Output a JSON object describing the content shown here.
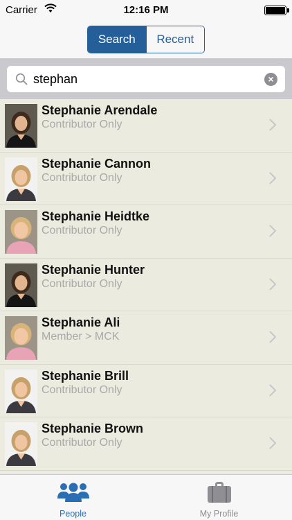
{
  "status_bar": {
    "carrier": "Carrier",
    "time": "12:16 PM"
  },
  "nav": {
    "segments": [
      {
        "label": "Search",
        "selected": true
      },
      {
        "label": "Recent",
        "selected": false
      }
    ]
  },
  "search": {
    "value": "stephan"
  },
  "people": [
    {
      "name": "Stephanie Arendale",
      "role": "Contributor Only",
      "photo": "woman-dark-hair"
    },
    {
      "name": "Stephanie Cannon",
      "role": "Contributor Only",
      "photo": "woman-light-hair"
    },
    {
      "name": "Stephanie Heidtke",
      "role": "Contributor Only",
      "photo": "child-blonde"
    },
    {
      "name": "Stephanie Hunter",
      "role": "Contributor Only",
      "photo": "woman-dark-hair"
    },
    {
      "name": "Stephanie Ali",
      "role": "Member > MCK",
      "photo": "child-blonde"
    },
    {
      "name": "Stephanie Brill",
      "role": "Contributor Only",
      "photo": "woman-light-hair"
    },
    {
      "name": "Stephanie Brown",
      "role": "Contributor Only",
      "photo": "woman-light-hair"
    }
  ],
  "tabs": [
    {
      "label": "People",
      "icon": "people-icon",
      "active": true
    },
    {
      "label": "My Profile",
      "icon": "briefcase-icon",
      "active": false
    }
  ],
  "colors": {
    "accent": "#245f9a",
    "tab_active": "#2a6fb6",
    "list_bg": "#ecebdf",
    "secondary_text": "#a9a9a9"
  }
}
